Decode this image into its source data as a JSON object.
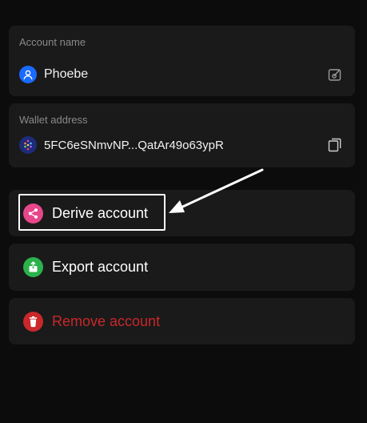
{
  "account": {
    "name_label": "Account name",
    "name_value": "Phoebe"
  },
  "wallet": {
    "address_label": "Wallet address",
    "address_value": "5FC6eSNmvNP...QatAr49o63ypR"
  },
  "actions": {
    "derive_label": "Derive account",
    "export_label": "Export account",
    "remove_label": "Remove account"
  },
  "colors": {
    "background": "#0c0c0c",
    "card": "#1a1a1a",
    "avatar_blue": "#1a6bff",
    "derive_pink": "#e8468a",
    "export_green": "#2bb24c",
    "remove_red": "#c9272a",
    "annotation": "#ffffff"
  },
  "icons": {
    "avatar": "user-icon",
    "edit": "edit-icon",
    "chain": "chain-logo-icon",
    "copy": "copy-icon",
    "derive": "share-icon",
    "export": "export-icon",
    "remove": "trash-icon"
  }
}
